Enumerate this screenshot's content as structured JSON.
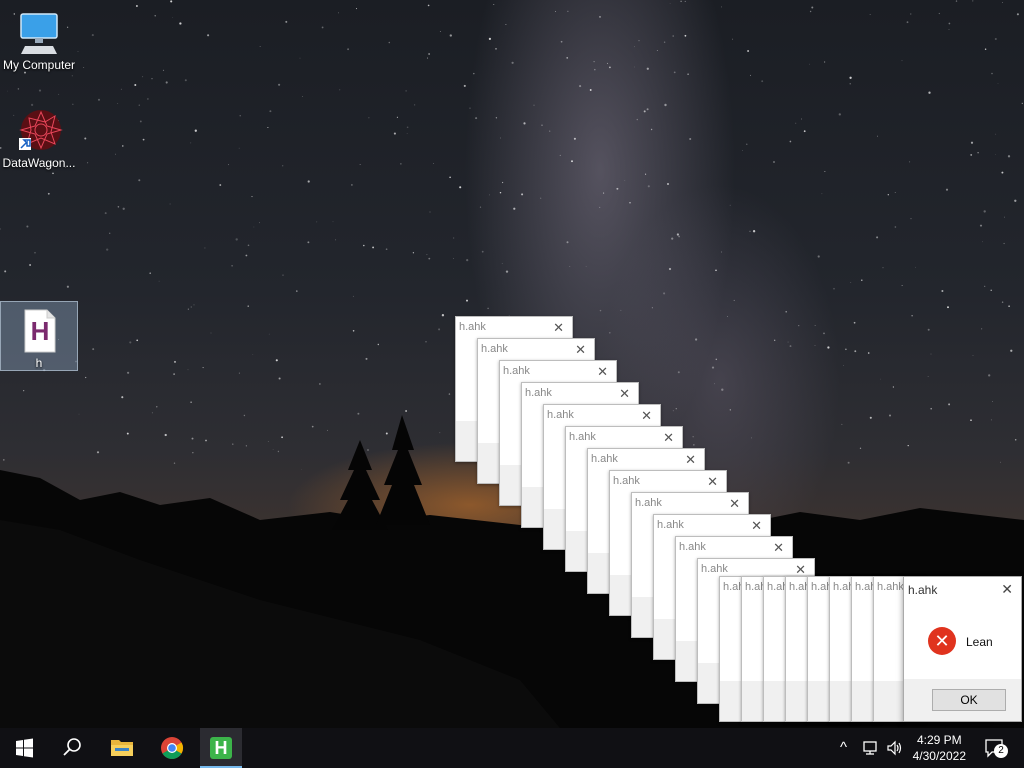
{
  "desktop": {
    "icons": [
      {
        "label": "My Computer",
        "icon": "computer-icon"
      },
      {
        "label": "DataWagon...",
        "icon": "datawagon-shortcut-icon"
      },
      {
        "label": "h",
        "icon": "ahk-script-file-icon",
        "glyph": "H",
        "selected": true
      }
    ]
  },
  "dialogs": {
    "title": "h.ahk",
    "close_glyph": "✕",
    "count_behind": 20
  },
  "active_dialog": {
    "title": "h.ahk",
    "close_glyph": "✕",
    "icon": "error-icon",
    "icon_glyph": "✕",
    "message": "Lean",
    "ok_label": "OK"
  },
  "taskbar": {
    "start_icon": "windows-start-icon",
    "search_icon": "search-icon",
    "pinned": [
      {
        "name": "file-explorer",
        "icon": "folder-icon"
      },
      {
        "name": "chrome",
        "icon": "chrome-icon"
      },
      {
        "name": "autohotkey",
        "icon": "autohotkey-icon",
        "glyph": "H",
        "active": true
      }
    ],
    "tray": {
      "chevron": "^",
      "network_icon": "network-icon",
      "volume_icon": "volume-icon",
      "time": "4:29 PM",
      "date": "4/30/2022",
      "notification_count": "2"
    }
  },
  "colors": {
    "error_red": "#e0331e",
    "ahk_green": "#3cb44a",
    "ahk_purple": "#7b2a6e"
  }
}
